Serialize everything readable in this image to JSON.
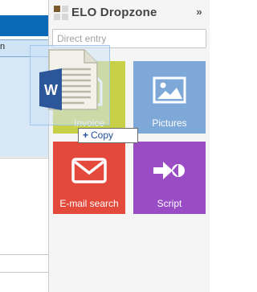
{
  "background_window": {
    "row_text": "n"
  },
  "panel": {
    "title": "ELO Dropzone",
    "search_placeholder": "Direct entry",
    "tiles": [
      {
        "label": "Invoice",
        "color": "#c8d048",
        "icon": "document-lines-icon"
      },
      {
        "label": "Pictures",
        "color": "#7ea8d8",
        "icon": "image-icon"
      },
      {
        "label": "E-mail search",
        "color": "#e34a3c",
        "icon": "envelope-icon"
      },
      {
        "label": "Script",
        "color": "#9a4cc4",
        "icon": "script-arrow-icon"
      }
    ]
  },
  "drag": {
    "file_icon": "word-document-icon",
    "file_letter": "W",
    "tooltip_action": "Copy",
    "tooltip_symbol": "+"
  }
}
